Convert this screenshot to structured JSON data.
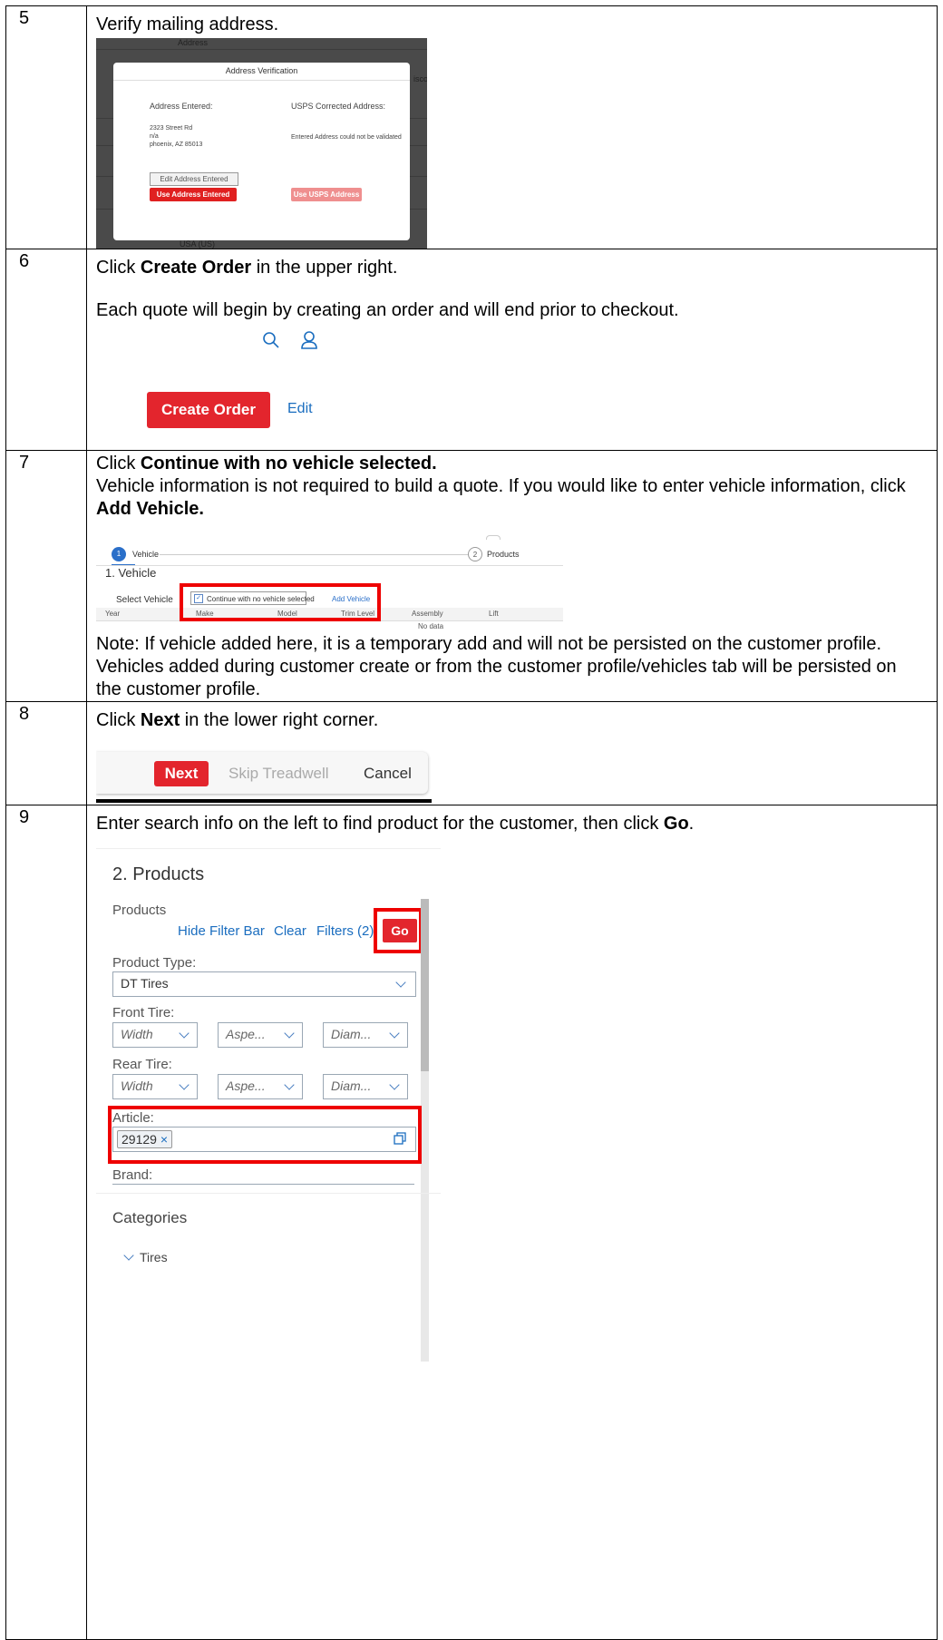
{
  "steps": {
    "s5": {
      "number": "5",
      "text": "Verify mailing address.",
      "shot": {
        "bg_label_top": "Address",
        "bg_label_right": "isco",
        "bg_label_bottom": "USA (US)",
        "dialog_title": "Address Verification",
        "entered_heading": "Address Entered:",
        "usps_heading": "USPS Corrected Address:",
        "addr_line1": "2323 Street Rd",
        "addr_line2": "n/a",
        "addr_line3": "phoenix, AZ 85013",
        "usps_message": "Entered Address could not be validated",
        "edit_button": "Edit Address Entered",
        "use_entered_button": "Use Address Entered",
        "use_usps_button": "Use USPS Address"
      }
    },
    "s6": {
      "number": "6",
      "text_pre": "Click ",
      "text_bold": "Create Order",
      "text_post": " in the upper right.",
      "text2": "Each quote will begin by creating an order and will end prior to checkout.",
      "shot": {
        "search_icon": "search-icon",
        "user_icon": "user-icon",
        "create_order": "Create Order",
        "edit": "Edit"
      }
    },
    "s7": {
      "number": "7",
      "line1_pre": "Click ",
      "line1_bold": "Continue with no vehicle selected.",
      "line2": "Vehicle information is not required to build a quote. If you would like to enter vehicle information, click ",
      "line2_bold": "Add Vehicle.",
      "shot": {
        "step1_num": "1",
        "step1_label": "Vehicle",
        "step2_num": "2",
        "step2_label": "Products",
        "section_title": "1. Vehicle",
        "select_vehicle": "Select Vehicle",
        "checkbox_label": "Continue with no vehicle selected",
        "add_vehicle": "Add Vehicle",
        "columns": [
          "Year",
          "Make",
          "Model",
          "Trim Level",
          "Assembly",
          "Lift"
        ],
        "no_data": "No data"
      },
      "note": "Note: If vehicle added here, it is a temporary add and will not be persisted on the customer profile. Vehicles added during customer create or from the customer profile/vehicles tab will be persisted on the customer profile."
    },
    "s8": {
      "number": "8",
      "text_pre": "Click ",
      "text_bold": "Next",
      "text_post": " in the lower right corner.",
      "shot": {
        "next": "Next",
        "skip": "Skip Treadwell",
        "cancel": "Cancel"
      }
    },
    "s9": {
      "number": "9",
      "text_pre": "Enter search info on the left to find product for the customer, then click ",
      "text_bold": "Go",
      "text_post": ".",
      "shot": {
        "title": "2. Products",
        "products_label": "Products",
        "hide_filter": "Hide Filter Bar",
        "clear": "Clear",
        "filters": "Filters (2)",
        "go": "Go",
        "product_type_label": "Product Type:",
        "product_type_value": "DT Tires",
        "front_tire_label": "Front Tire:",
        "rear_tire_label": "Rear Tire:",
        "width": "Width",
        "aspect": "Aspe...",
        "diam": "Diam...",
        "article_label": "Article:",
        "article_token": "29129",
        "brand_label": "Brand:",
        "categories": "Categories",
        "tires": "Tires"
      }
    }
  }
}
